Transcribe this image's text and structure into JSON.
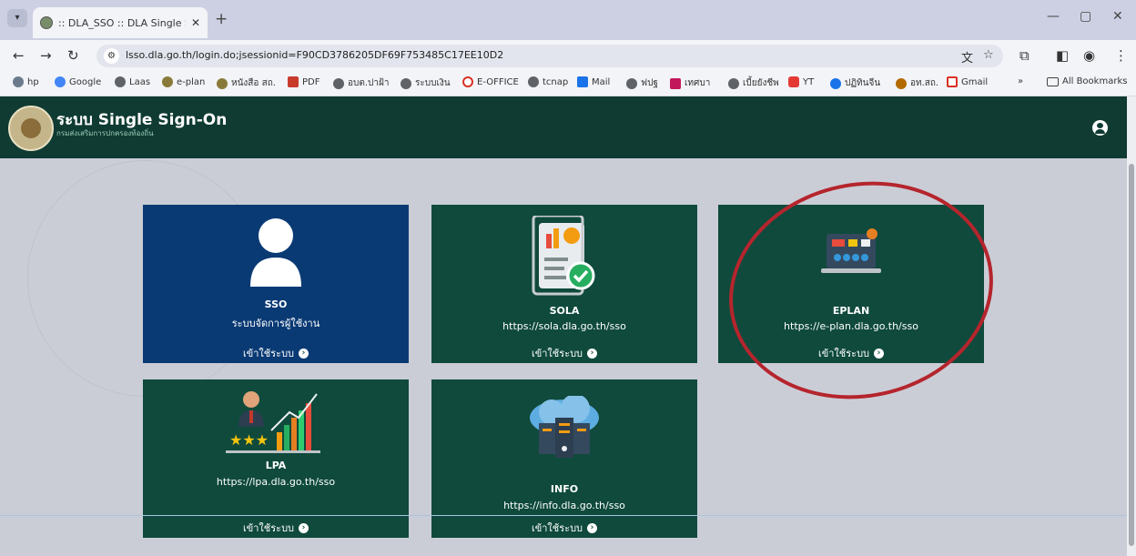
{
  "browser": {
    "tab_title": ":: DLA_SSO :: DLA Single Sign-On",
    "new_tab": "+",
    "url": "lsso.dla.go.th/login.do;jsessionid=F90CD3786205DF69F753485C17EE10D2",
    "controls": {
      "minimize": "—",
      "maximize": "▢",
      "close": "✕",
      "back": "←",
      "forward": "→",
      "reload": "↻"
    },
    "bookmarks": [
      {
        "label": "hp",
        "color": "#6b7b8c"
      },
      {
        "label": "Google",
        "color": "#4285f4"
      },
      {
        "label": "Laas",
        "color": "#5f6368"
      },
      {
        "label": "e-plan",
        "color": "#8a7a3a"
      },
      {
        "label": "หนังสือ สถ.",
        "color": "#8a7a3a"
      },
      {
        "label": "PDF",
        "color": "#c83a2a"
      },
      {
        "label": "อบต.ปาฝ้า",
        "color": "#5f6368"
      },
      {
        "label": "ระบบเงิน",
        "color": "#5f6368"
      },
      {
        "label": "E-OFFICE",
        "color": "#d93025"
      },
      {
        "label": "tcnap",
        "color": "#5f6368"
      },
      {
        "label": "Mail",
        "color": "#1a73e8"
      },
      {
        "label": "ฟปฐ",
        "color": "#5f6368"
      },
      {
        "label": "เทศบา",
        "color": "#c2185b"
      },
      {
        "label": "เบี้ยยังชีพ",
        "color": "#5f6368"
      },
      {
        "label": "YT",
        "color": "#e53935"
      },
      {
        "label": "ปฏิทินจีน",
        "color": "#1a73e8"
      },
      {
        "label": "อท.สถ.",
        "color": "#b26a00"
      },
      {
        "label": "Gmail",
        "color": "#d93025"
      }
    ],
    "more_bookmarks": "»",
    "all_bookmarks": "All Bookmarks"
  },
  "app": {
    "title": "ระบบ Single Sign-On",
    "subtitle": "กรมส่งเสริมการปกครองท้องถิ่น"
  },
  "cards": [
    {
      "name": "SSO",
      "url": "ระบบจัดการผู้ใช้งาน",
      "enter": "เข้าใช้ระบบ",
      "icon": "user-silhouette-icon",
      "color": "#0a3a74"
    },
    {
      "name": "SOLA",
      "url": "https://sola.dla.go.th/sso",
      "enter": "เข้าใช้ระบบ",
      "icon": "report-check-icon",
      "color": "#0f4a3c"
    },
    {
      "name": "EPLAN",
      "url": "https://e-plan.dla.go.th/sso",
      "enter": "เข้าใช้ระบบ",
      "icon": "plan-board-icon",
      "color": "#0f4a3c"
    },
    {
      "name": "LPA",
      "url": "https://lpa.dla.go.th/sso",
      "enter": "เข้าใช้ระบบ",
      "icon": "performance-chart-icon",
      "color": "#0f4a3c"
    },
    {
      "name": "INFO",
      "url": "https://info.dla.go.th/sso",
      "enter": "เข้าใช้ระบบ",
      "icon": "cloud-server-icon",
      "color": "#0f4a3c"
    }
  ],
  "colors": {
    "header": "#0f3b33",
    "highlight": "#b5252d"
  }
}
